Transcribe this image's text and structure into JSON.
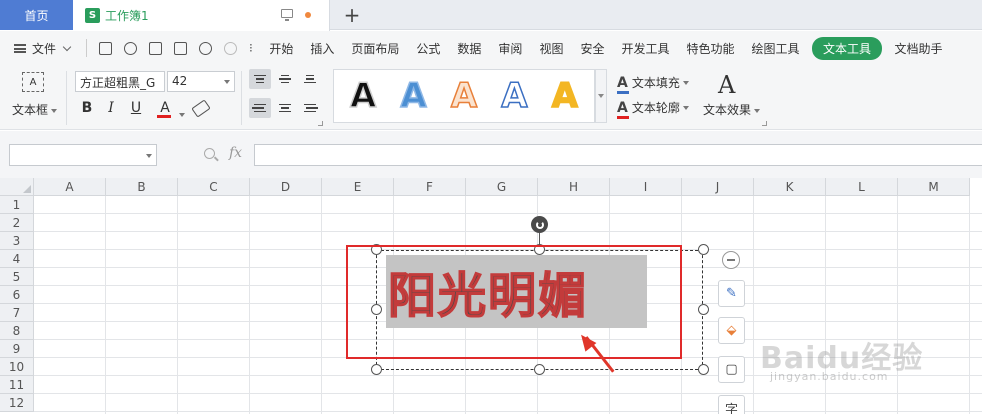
{
  "tabs": {
    "home": "首页",
    "workbook": "工作簿1",
    "workbook_icon": "S"
  },
  "menu": {
    "file": "文件",
    "more": "⁝",
    "items": [
      "开始",
      "插入",
      "页面布局",
      "公式",
      "数据",
      "审阅",
      "视图",
      "安全",
      "开发工具",
      "特色功能",
      "绘图工具",
      "文本工具",
      "文档助手"
    ],
    "active": "文本工具"
  },
  "ribbon": {
    "textbox_icon": "A",
    "textbox_label": "文本框",
    "font_name": "方正超粗黑_G",
    "font_size": "42",
    "bold": "B",
    "italic": "I",
    "underline": "U",
    "font_color_letter": "A",
    "style_letters": [
      {
        "letter": "A",
        "fill": "#111111",
        "stroke": "#cfcfcf"
      },
      {
        "letter": "A",
        "fill": "#4c8fd3",
        "stroke": "#8fb8e6"
      },
      {
        "letter": "A",
        "fill": "#fbe3cf",
        "stroke": "#e8803a"
      },
      {
        "letter": "A",
        "fill": "#ffffff",
        "stroke": "#3b6fc2"
      },
      {
        "letter": "A",
        "fill": "#f3b623",
        "stroke": "#f3b623"
      }
    ],
    "text_fill": "文本填充",
    "text_outline": "文本轮廓",
    "text_effect": "文本效果",
    "effect_icon": "A"
  },
  "formula": {
    "fx": "fx"
  },
  "sheet": {
    "columns": [
      "A",
      "B",
      "C",
      "D",
      "E",
      "F",
      "G",
      "H",
      "I",
      "J",
      "K",
      "L",
      "M"
    ],
    "rows": [
      "1",
      "2",
      "3",
      "4",
      "5",
      "6",
      "7",
      "8",
      "9",
      "10",
      "11",
      "12"
    ]
  },
  "textbox_object": {
    "text": "阳光明媚"
  },
  "float_buttons": {
    "minus": "−",
    "brush": "✎",
    "fill": "⬙",
    "frame": "▢",
    "text": "字"
  },
  "colors": {
    "accent": "#2a9d5c",
    "home_tab": "#4f7cd3",
    "highlight": "#e02a2a"
  }
}
